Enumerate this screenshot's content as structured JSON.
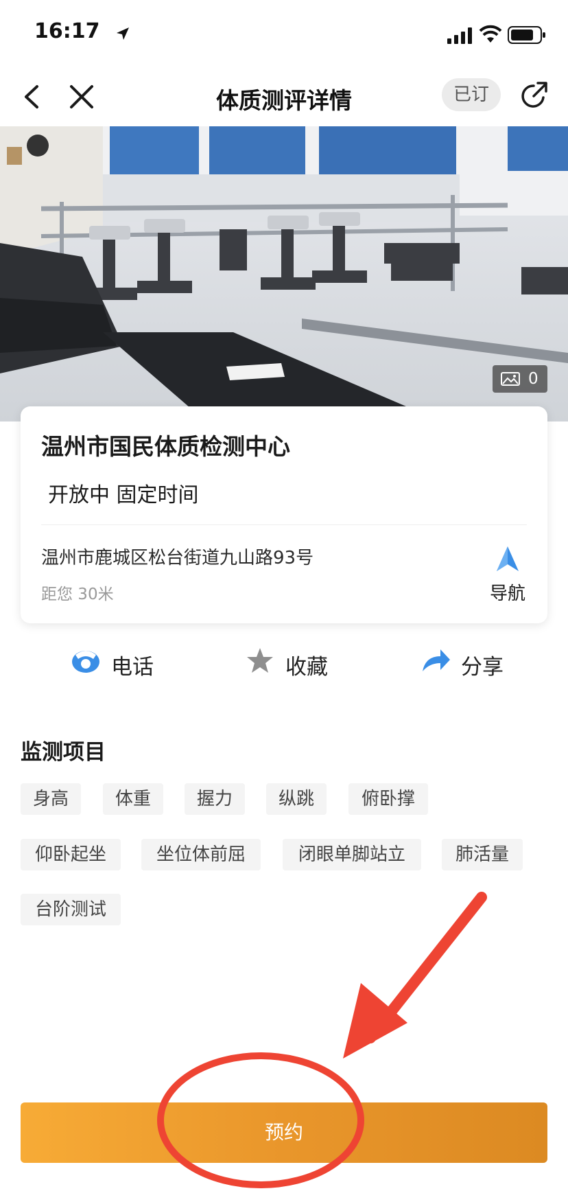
{
  "status_bar": {
    "time": "16:17"
  },
  "nav": {
    "title": "体质测评详情",
    "subscribed": "已订"
  },
  "hero": {
    "photo_count": "0"
  },
  "venue": {
    "name": "温州市国民体质检测中心",
    "status": "开放中 固定时间",
    "address": "温州市鹿城区松台街道九山路93号",
    "distance": "距您 30米",
    "nav_label": "导航"
  },
  "actions": {
    "phone": "电话",
    "favorite": "收藏",
    "share": "分享"
  },
  "monitoring": {
    "title": "监测项目",
    "items": [
      "身高",
      "体重",
      "握力",
      "纵跳",
      "俯卧撑",
      "仰卧起坐",
      "坐位体前屈",
      "闭眼单脚站立",
      "肺活量",
      "台阶测试"
    ]
  },
  "book_button": "预约",
  "colors": {
    "accent_orange": "#f0a030",
    "annotation_red": "#ee4433",
    "icon_blue": "#3a8ee6"
  }
}
